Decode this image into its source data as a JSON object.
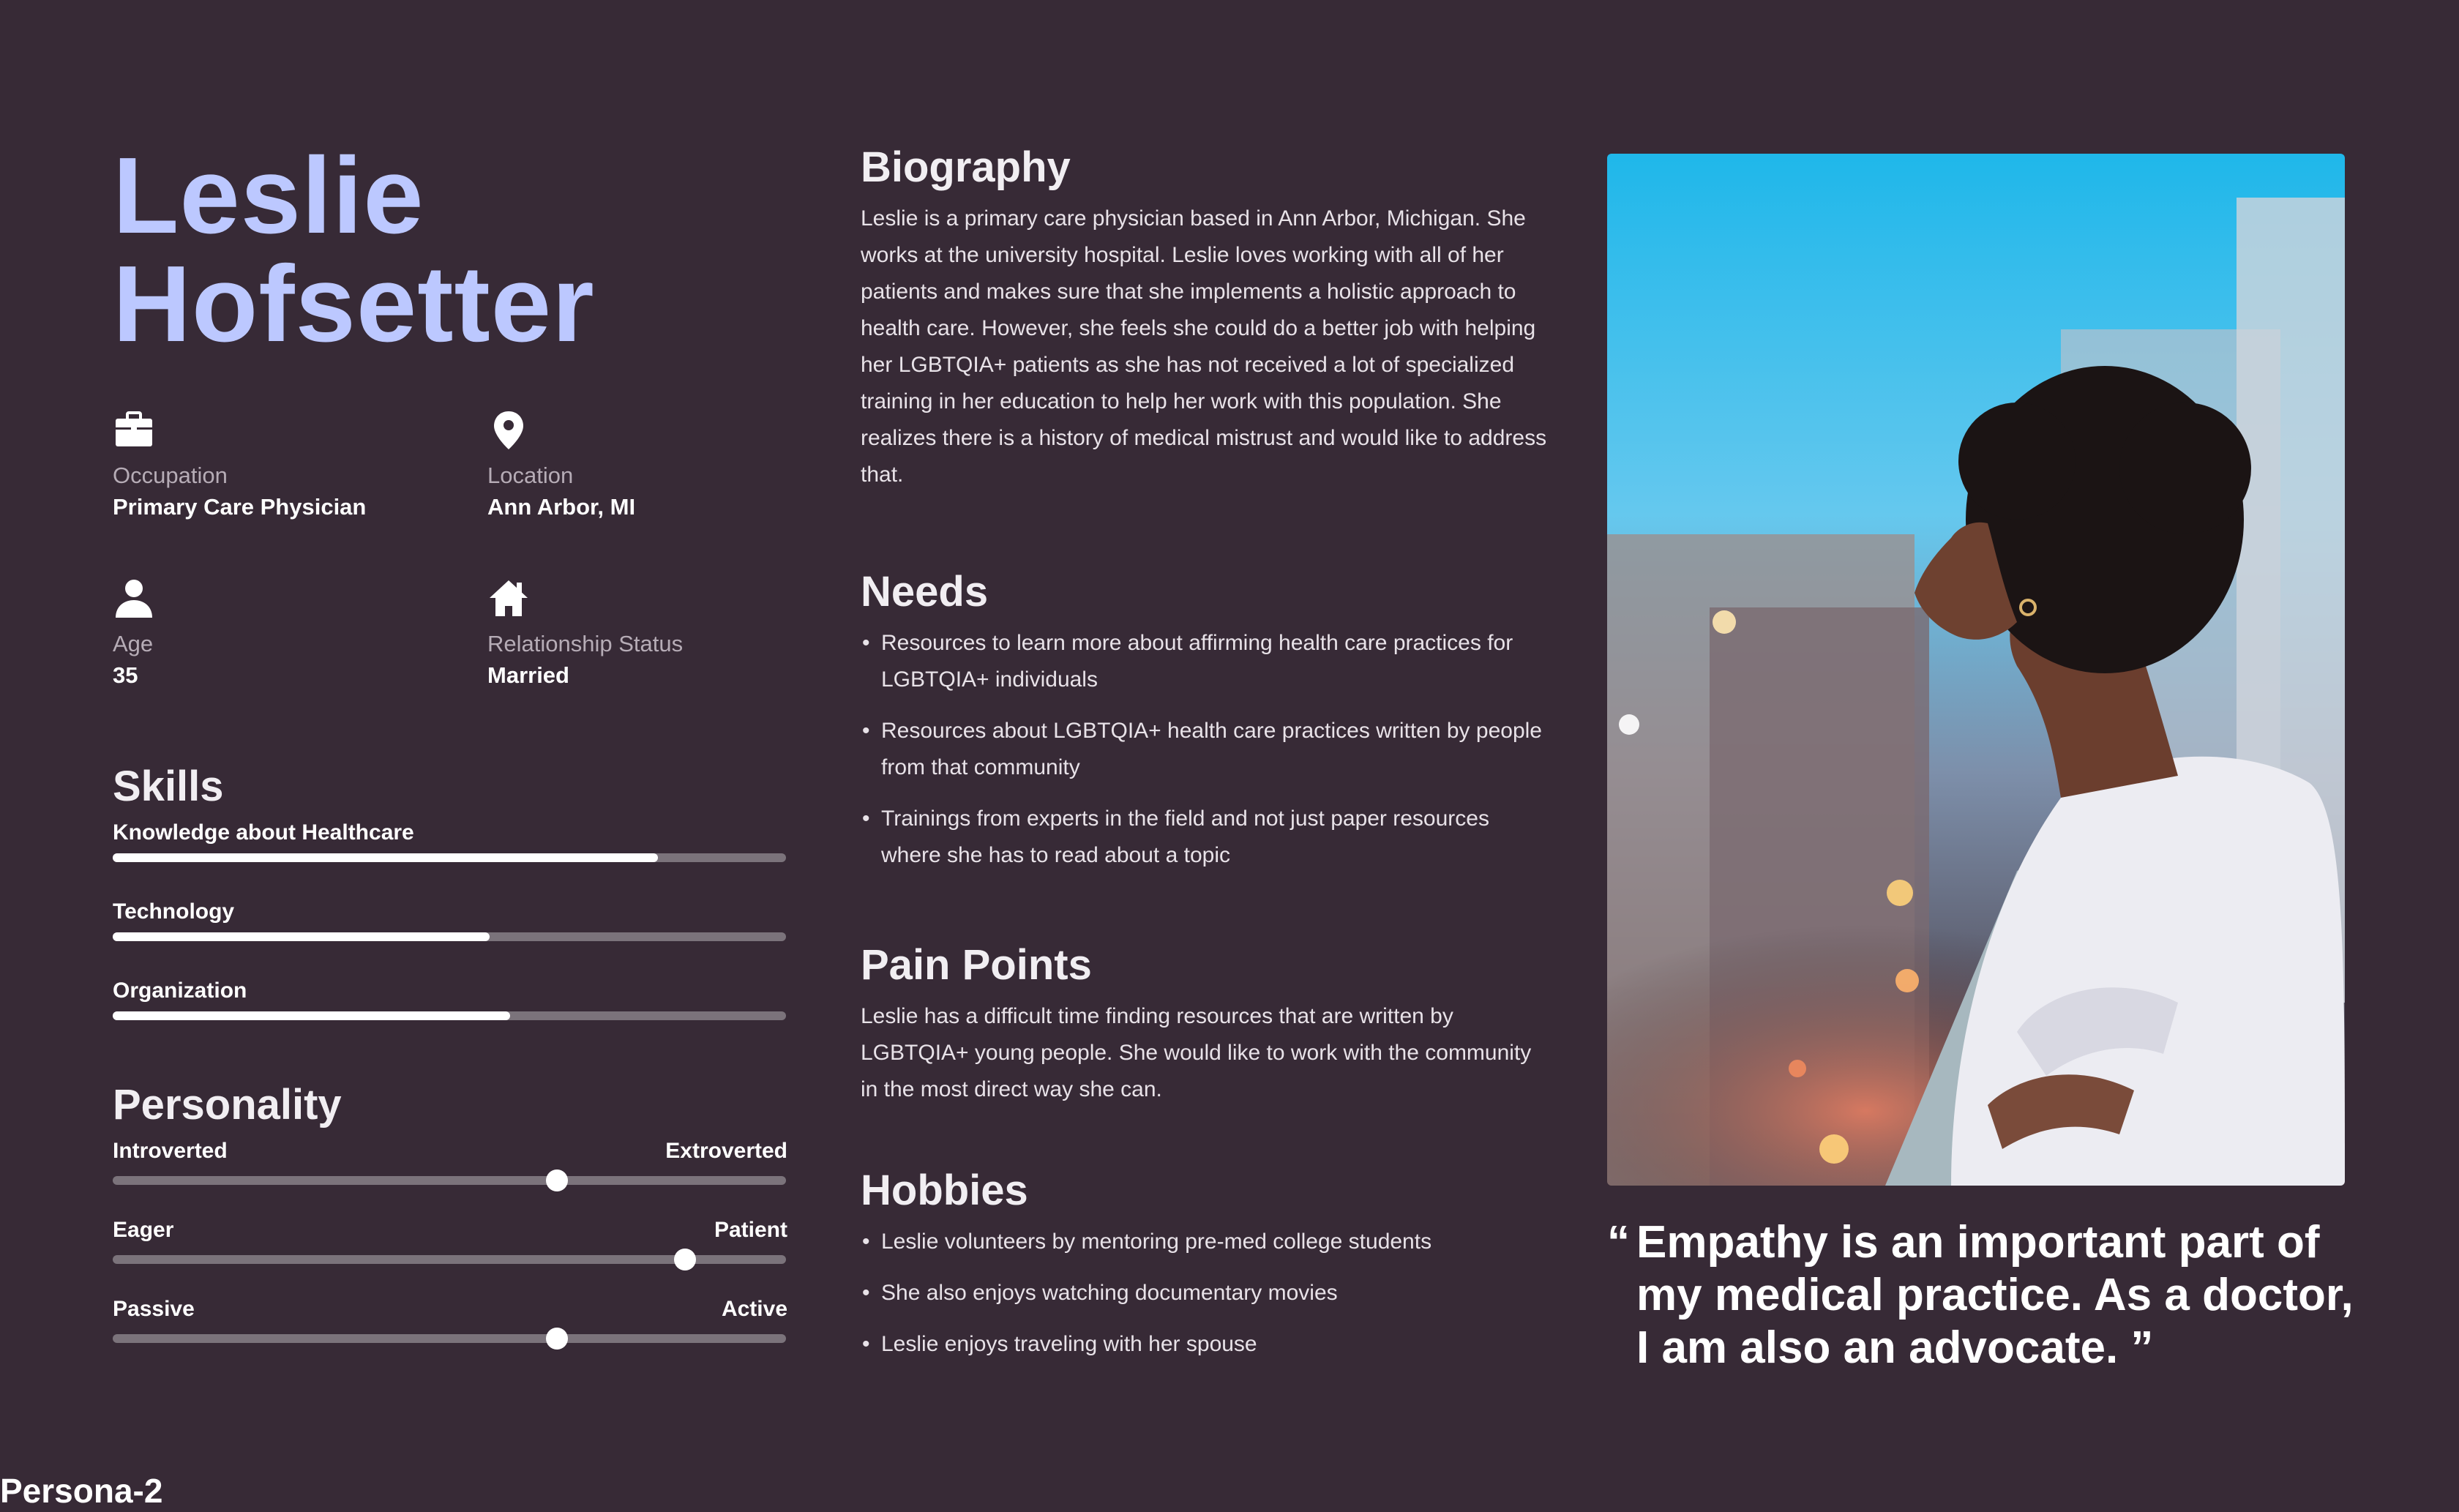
{
  "persona": {
    "first_name": "Leslie",
    "last_name": "Hofsetter"
  },
  "info": {
    "occupation_label": "Occupation",
    "occupation_value": "Primary Care Physician",
    "location_label": "Location",
    "location_value": "Ann Arbor, MI",
    "age_label": "Age",
    "age_value": "35",
    "relationship_label": "Relationship Status",
    "relationship_value": "Married",
    "icons": [
      "briefcase-icon",
      "location-pin-icon",
      "person-icon",
      "home-icon"
    ]
  },
  "skills": {
    "title": "Skills",
    "items": [
      {
        "label": "Knowledge about Healthcare",
        "level": 0.81
      },
      {
        "label": "Technology",
        "level": 0.56
      },
      {
        "label": "Organization",
        "level": 0.59
      }
    ]
  },
  "personality": {
    "title": "Personality",
    "traits": [
      {
        "left": "Introverted",
        "right": "Extroverted",
        "value": 0.66
      },
      {
        "left": "Eager",
        "right": "Patient",
        "value": 0.85
      },
      {
        "left": "Passive",
        "right": "Active",
        "value": 0.66
      }
    ]
  },
  "biography": {
    "title": "Biography",
    "text": "Leslie is a primary care physician based in Ann Arbor, Michigan. She works at the university hospital. Leslie loves working with all of her patients and makes sure that she implements a holistic approach to health care. However, she feels she could do a better job with helping her LGBTQIA+ patients as she has not received a lot of specialized training in her education to help her work with this population. She realizes there is a history of medical mistrust and would like to address that."
  },
  "needs": {
    "title": "Needs",
    "items": [
      "Resources to learn more about affirming health care practices for LGBTQIA+ individuals",
      "Resources about LGBTQIA+ health care practices written by people from that community",
      "Trainings from experts in the field and not just paper resources where she has to read about a topic"
    ]
  },
  "pain_points": {
    "title": "Pain Points",
    "text": "Leslie has a difficult time finding resources that are written by LGBTQIA+ young people. She would like to work with the community in the most direct way she can."
  },
  "hobbies": {
    "title": "Hobbies",
    "items": [
      "Leslie volunteers by mentoring pre-med college students",
      "She also enjoys watching documentary movies",
      "Leslie enjoys traveling with her spouse"
    ]
  },
  "quote": {
    "open": "“",
    "text": "Empathy is an important part of my medical practice. As a doctor, I am also an advocate. ”"
  },
  "footer": {
    "label": "Persona-2"
  },
  "colors": {
    "background": "#372a36",
    "name_accent": "#bcc8ff",
    "track": "#7b737b",
    "fill": "#ffffff"
  }
}
